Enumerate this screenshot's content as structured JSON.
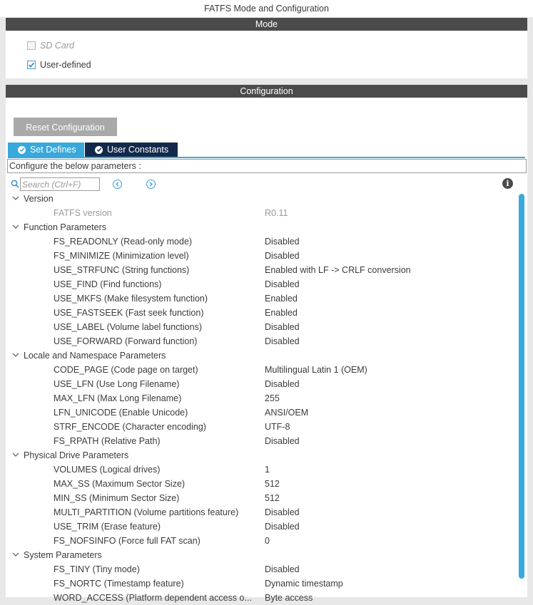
{
  "window": {
    "title": "FATFS Mode and Configuration"
  },
  "mode": {
    "header": "Mode",
    "options": [
      {
        "label": "SD Card",
        "checked": false,
        "enabled": false
      },
      {
        "label": "User-defined",
        "checked": true,
        "enabled": true
      }
    ]
  },
  "configuration": {
    "header": "Configuration",
    "reset_label": "Reset Configuration",
    "tabs": [
      {
        "label": "Set Defines",
        "active": true
      },
      {
        "label": "User Constants",
        "active": false
      }
    ],
    "hint": "Configure the below parameters :",
    "search": {
      "placeholder": "Search (Ctrl+F)"
    }
  },
  "groups": [
    {
      "name": "Version",
      "params": [
        {
          "name": "FATFS version",
          "value": "R0.11",
          "readonly": true
        }
      ]
    },
    {
      "name": "Function Parameters",
      "params": [
        {
          "name": "FS_READONLY (Read-only mode)",
          "value": "Disabled"
        },
        {
          "name": "FS_MINIMIZE (Minimization level)",
          "value": "Disabled"
        },
        {
          "name": "USE_STRFUNC (String functions)",
          "value": "Enabled with LF -> CRLF conversion"
        },
        {
          "name": "USE_FIND (Find functions)",
          "value": "Disabled"
        },
        {
          "name": "USE_MKFS (Make filesystem function)",
          "value": "Enabled"
        },
        {
          "name": "USE_FASTSEEK (Fast seek function)",
          "value": "Enabled"
        },
        {
          "name": "USE_LABEL (Volume label functions)",
          "value": "Disabled"
        },
        {
          "name": "USE_FORWARD (Forward function)",
          "value": "Disabled"
        }
      ]
    },
    {
      "name": "Locale and Namespace Parameters",
      "params": [
        {
          "name": "CODE_PAGE (Code page on target)",
          "value": "Multilingual Latin 1 (OEM)"
        },
        {
          "name": "USE_LFN (Use Long Filename)",
          "value": "Disabled"
        },
        {
          "name": "MAX_LFN (Max Long Filename)",
          "value": "255"
        },
        {
          "name": "LFN_UNICODE (Enable Unicode)",
          "value": "ANSI/OEM"
        },
        {
          "name": "STRF_ENCODE (Character encoding)",
          "value": "UTF-8"
        },
        {
          "name": "FS_RPATH (Relative Path)",
          "value": "Disabled"
        }
      ]
    },
    {
      "name": "Physical Drive Parameters",
      "params": [
        {
          "name": "VOLUMES (Logical drives)",
          "value": "1"
        },
        {
          "name": "MAX_SS (Maximum Sector Size)",
          "value": "512"
        },
        {
          "name": "MIN_SS (Minimum Sector Size)",
          "value": "512"
        },
        {
          "name": "MULTI_PARTITION (Volume partitions feature)",
          "value": "Disabled"
        },
        {
          "name": "USE_TRIM (Erase feature)",
          "value": "Disabled"
        },
        {
          "name": "FS_NOFSINFO (Force full FAT scan)",
          "value": "0"
        }
      ]
    },
    {
      "name": "System Parameters",
      "params": [
        {
          "name": "FS_TINY (Tiny mode)",
          "value": "Disabled"
        },
        {
          "name": "FS_NORTC (Timestamp feature)",
          "value": "Dynamic timestamp"
        },
        {
          "name": "WORD_ACCESS (Platform dependent access o...",
          "value": "Byte access"
        }
      ]
    }
  ],
  "colors": {
    "header_bar": "#4b4b4b",
    "accent": "#39a8db",
    "tab_inactive": "#13294b"
  }
}
